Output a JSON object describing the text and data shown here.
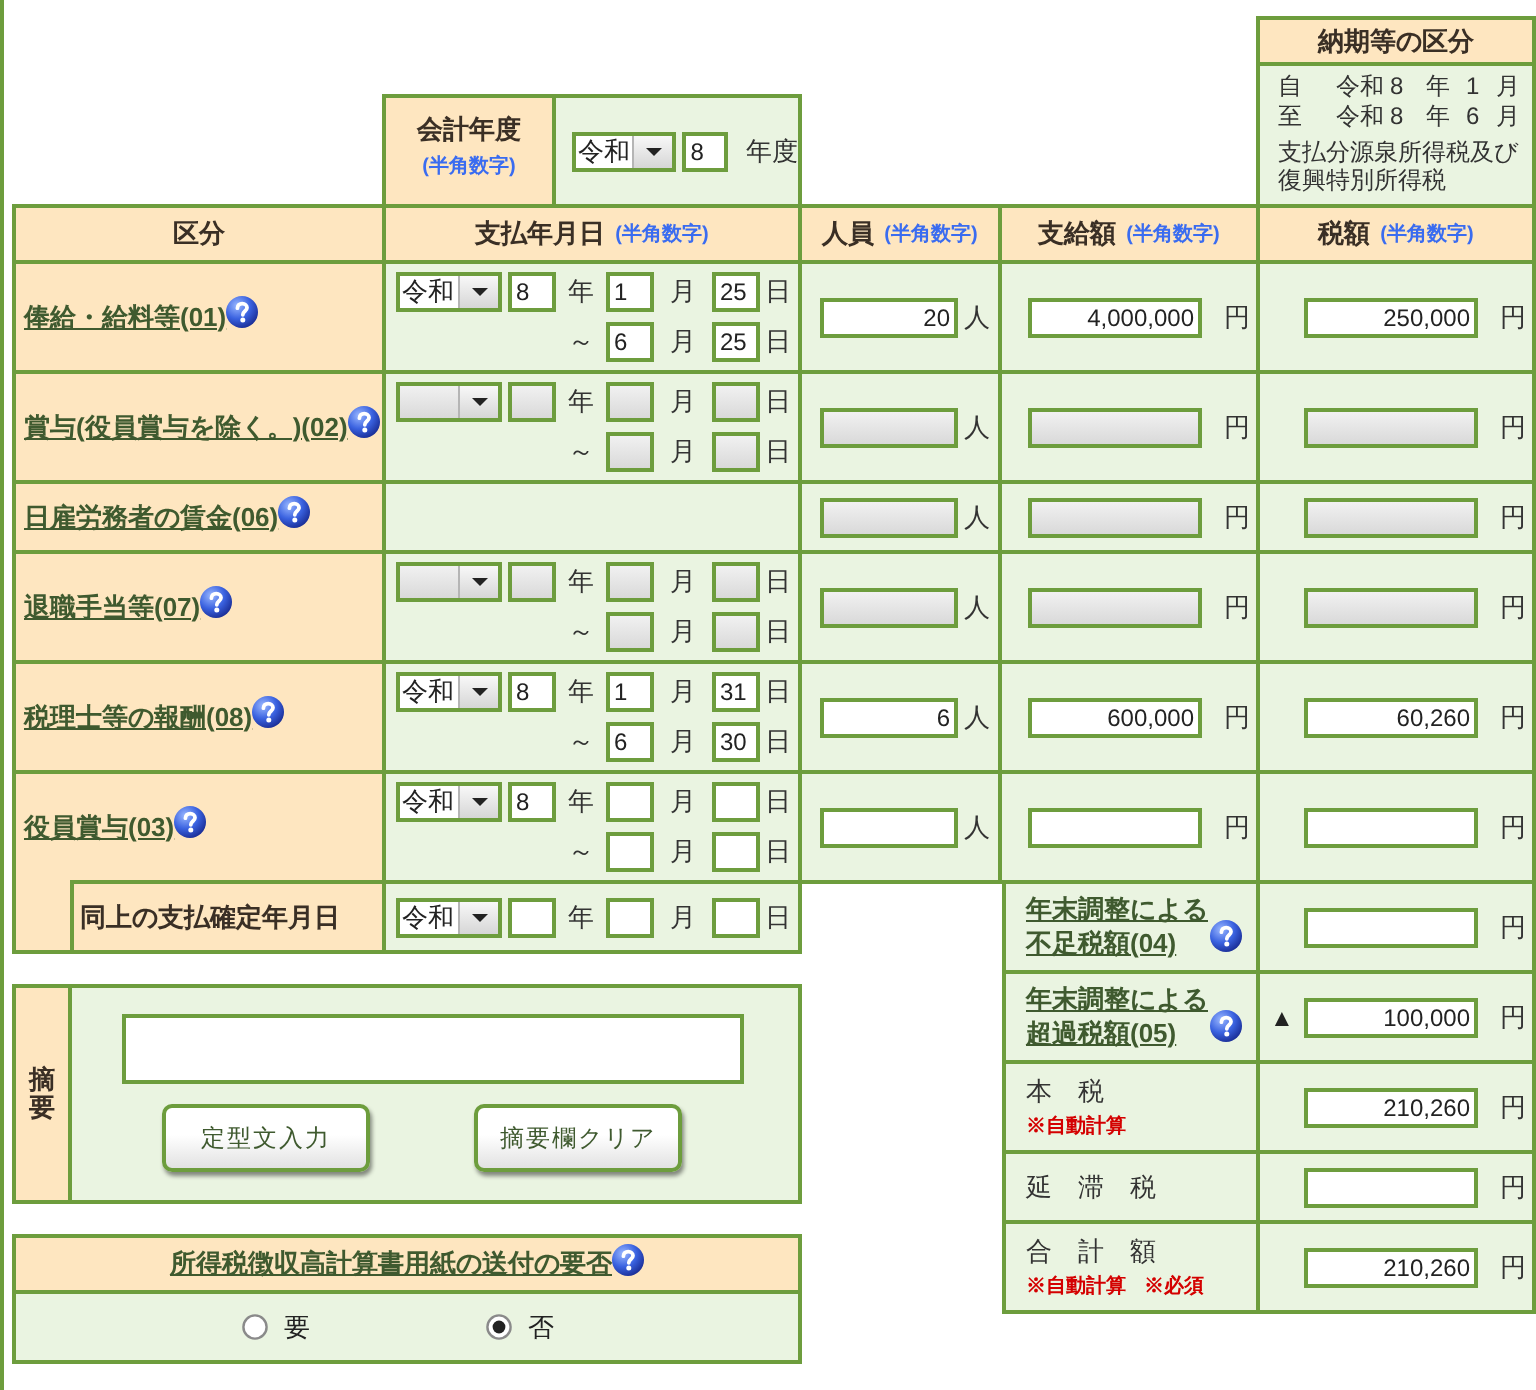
{
  "fiscal_year": {
    "label": "会計年度",
    "hint": "(半角数字)",
    "era": "令和",
    "year": "8",
    "unit": "年度"
  },
  "period": {
    "title": "納期等の区分",
    "lines": [
      {
        "label": "自",
        "era": "令和",
        "year": "8",
        "year_unit": "年",
        "month": "1",
        "month_unit": "月"
      },
      {
        "label": "至",
        "era": "令和",
        "year": "8",
        "year_unit": "年",
        "month": "6",
        "month_unit": "月"
      }
    ],
    "description": "支払分源泉所得税及び復興特別所得税"
  },
  "table": {
    "columns": [
      {
        "label": "区分"
      },
      {
        "label": "支払年月日",
        "hint": "(半角数字)"
      },
      {
        "label": "人員",
        "hint": "(半角数字)"
      },
      {
        "label": "支給額",
        "hint": "(半角数字)"
      },
      {
        "label": "税額",
        "hint": "(半角数字)"
      }
    ],
    "rows": [
      {
        "label": "俸給・給料等(01)",
        "disabled": false,
        "date": {
          "era": "令和",
          "year": "8",
          "year_unit": "年",
          "from": {
            "month": "1",
            "month_unit": "月",
            "day": "25",
            "day_unit": "日"
          },
          "to": {
            "mark": "～",
            "month": "6",
            "month_unit": "月",
            "day": "25",
            "day_unit": "日"
          }
        },
        "persons": {
          "value": "20",
          "unit": "人"
        },
        "payment": {
          "value": "4,000,000",
          "unit": "円"
        },
        "tax": {
          "value": "250,000",
          "unit": "円"
        }
      },
      {
        "label": "賞与(役員賞与を除く。)(02)",
        "disabled": true,
        "date": {
          "year_unit": "年",
          "from": {
            "month_unit": "月",
            "day_unit": "日"
          },
          "to": {
            "mark": "～",
            "month_unit": "月",
            "day_unit": "日"
          }
        },
        "persons": {
          "unit": "人"
        },
        "payment": {
          "unit": "円"
        },
        "tax": {
          "unit": "円"
        }
      },
      {
        "label": "日雇労務者の賃金(06)",
        "disabled": true,
        "persons": {
          "unit": "人"
        },
        "payment": {
          "unit": "円"
        },
        "tax": {
          "unit": "円"
        }
      },
      {
        "label": "退職手当等(07)",
        "disabled": true,
        "date": {
          "year_unit": "年",
          "from": {
            "month_unit": "月",
            "day_unit": "日"
          },
          "to": {
            "mark": "～",
            "month_unit": "月",
            "day_unit": "日"
          }
        },
        "persons": {
          "unit": "人"
        },
        "payment": {
          "unit": "円"
        },
        "tax": {
          "unit": "円"
        }
      },
      {
        "label": "税理士等の報酬(08)",
        "disabled": false,
        "date": {
          "era": "令和",
          "year": "8",
          "year_unit": "年",
          "from": {
            "month": "1",
            "month_unit": "月",
            "day": "31",
            "day_unit": "日"
          },
          "to": {
            "mark": "～",
            "month": "6",
            "month_unit": "月",
            "day": "30",
            "day_unit": "日"
          }
        },
        "persons": {
          "value": "6",
          "unit": "人"
        },
        "payment": {
          "value": "600,000",
          "unit": "円"
        },
        "tax": {
          "value": "60,260",
          "unit": "円"
        }
      },
      {
        "label": "役員賞与(03)",
        "disabled": false,
        "date": {
          "era": "令和",
          "year": "8",
          "year_unit": "年",
          "from": {
            "month_unit": "月",
            "day_unit": "日"
          },
          "to": {
            "mark": "～",
            "month_unit": "月",
            "day_unit": "日"
          }
        },
        "persons": {
          "unit": "人"
        },
        "payment": {
          "unit": "円"
        },
        "tax": {
          "unit": "円"
        }
      }
    ]
  },
  "confirmed_date": {
    "label": "同上の支払確定年月日",
    "date": {
      "era": "令和",
      "year_unit": "年",
      "from": {
        "month_unit": "月",
        "day_unit": "日"
      }
    }
  },
  "summary": [
    {
      "kind": "link",
      "label": "年末調整による不足税額(04)",
      "unit": "円"
    },
    {
      "kind": "link",
      "label": "年末調整による超過税額(05)",
      "prefix": "▲",
      "value": "100,000",
      "unit": "円"
    },
    {
      "kind": "plain",
      "label": "本　税",
      "notes": [
        "※自動計算"
      ],
      "value": "210,260",
      "unit": "円"
    },
    {
      "kind": "plain",
      "label": "延　滞　税",
      "unit": "円"
    },
    {
      "kind": "plain",
      "label": "合　計　額",
      "notes": [
        "※自動計算",
        "※必須"
      ],
      "value": "210,260",
      "unit": "円"
    }
  ],
  "memo": {
    "label": "摘要",
    "buttons": [
      "定型文入力",
      "摘要欄クリア"
    ]
  },
  "send_paper": {
    "title": "所得税徴収高計算書用紙の送付の要否",
    "options": [
      {
        "label": "要",
        "selected": false
      },
      {
        "label": "否",
        "selected": true
      }
    ]
  }
}
